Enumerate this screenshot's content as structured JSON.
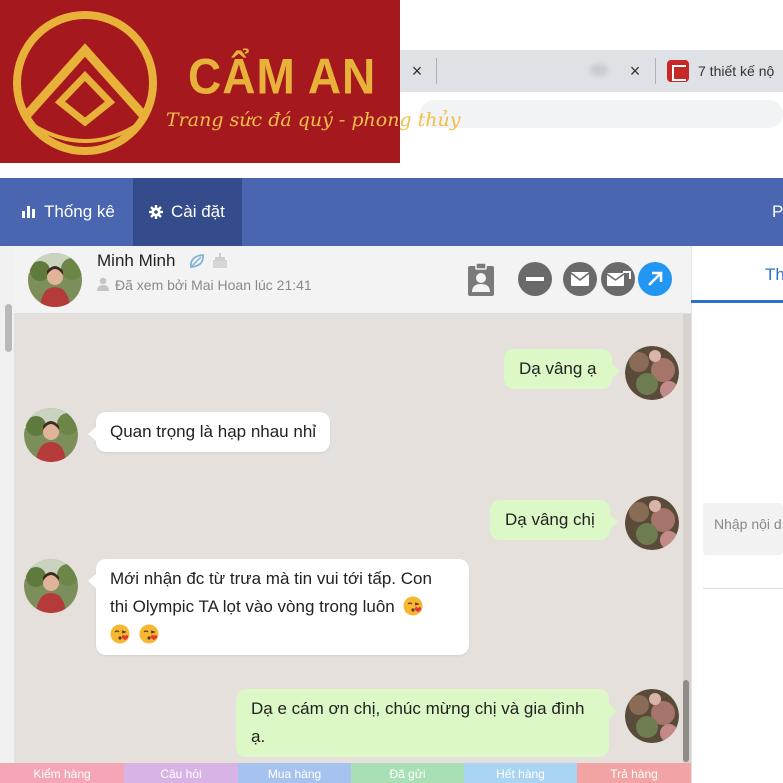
{
  "logo": {
    "brand_name": "CẨM AN",
    "tagline": "Trang sức đá quý - phong thủy",
    "colors": {
      "background": "#a5181e",
      "gold": "#e8b23a"
    }
  },
  "browser": {
    "tabs": [
      {
        "close_label": "×"
      },
      {
        "close_label": "×"
      },
      {
        "title": "7 thiết kế nộ",
        "favicon": "e-letter-favicon-icon"
      }
    ]
  },
  "topnav": {
    "items": [
      {
        "label": "Thống kê",
        "icon": "bar-chart-icon",
        "active": false
      },
      {
        "label": "Cài đặt",
        "icon": "gear-icon",
        "active": true
      }
    ],
    "right_label": "P",
    "colors": {
      "bar": "#4a66b0",
      "active": "#344c8c"
    }
  },
  "chat": {
    "header": {
      "contact_name": "Minh Minh",
      "seen_text": "Đã xem bởi Mai Hoan lúc 21:41",
      "icons": [
        "leaf-icon",
        "cake-icon",
        "contact-card-icon",
        "block-icon",
        "mail-icon",
        "mail-forward-icon",
        "open-external-icon"
      ]
    },
    "messages": [
      {
        "direction": "out",
        "lines": [
          "Dạ vâng ạ"
        ]
      },
      {
        "direction": "in",
        "lines": [
          "Quan trọng là hạp nhau nhỉ"
        ]
      },
      {
        "direction": "out",
        "lines": [
          "Dạ vâng chị"
        ]
      },
      {
        "direction": "in",
        "lines": [
          "Mới nhận đc từ trưa mà tin vui tới tấp. Con",
          "thi Olympic TA lọt vào vòng trong luôn",
          ""
        ],
        "emoji": "kissing-face-emoji"
      },
      {
        "direction": "out",
        "lines": [
          "Dạ e cám ơn chị, chúc mừng chị và gia đình",
          "ạ."
        ]
      }
    ]
  },
  "tags": [
    {
      "label": "Kiểm hàng",
      "color": "#f4a6b6"
    },
    {
      "label": "Câu hỏi",
      "color": "#d8b4e6"
    },
    {
      "label": "Mua hàng",
      "color": "#a6c3ef"
    },
    {
      "label": "Đã gửi",
      "color": "#a8dfb4"
    },
    {
      "label": "Hết hàng",
      "color": "#a9d4f2"
    },
    {
      "label": "Trả hàng",
      "color": "#f2a3a3"
    }
  ],
  "right_panel": {
    "tab_label": "Th",
    "input_placeholder": "Nhập nội d"
  }
}
